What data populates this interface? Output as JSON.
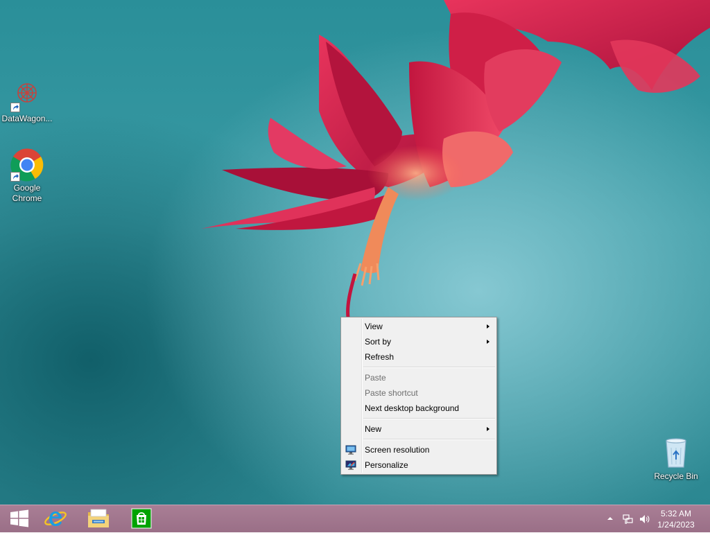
{
  "desktop": {
    "icons": [
      {
        "label": "DataWagon..."
      },
      {
        "label": "Google Chrome"
      },
      {
        "label": "Recycle Bin"
      }
    ]
  },
  "context_menu": {
    "items": [
      {
        "label": "View",
        "submenu": true,
        "enabled": true
      },
      {
        "label": "Sort by",
        "submenu": true,
        "enabled": true
      },
      {
        "label": "Refresh",
        "enabled": true
      },
      {
        "label": "Paste",
        "enabled": false
      },
      {
        "label": "Paste shortcut",
        "enabled": false
      },
      {
        "label": "Next desktop background",
        "enabled": true
      },
      {
        "label": "New",
        "submenu": true,
        "enabled": true
      },
      {
        "label": "Screen resolution",
        "icon": "display-icon",
        "enabled": true
      },
      {
        "label": "Personalize",
        "icon": "personalize-icon",
        "enabled": true
      }
    ]
  },
  "taskbar": {
    "pinned": [
      {
        "icon": "windows-start-icon"
      },
      {
        "icon": "internet-explorer-icon"
      },
      {
        "icon": "file-explorer-icon"
      },
      {
        "icon": "store-icon"
      }
    ],
    "tray": {
      "icons": [
        "show-hidden-icons-chevron",
        "network-icon",
        "volume-icon"
      ],
      "time": "5:32 AM",
      "date": "1/24/2023"
    }
  },
  "colors": {
    "taskbar": "#a47a90",
    "menu_background": "#f0f0f0",
    "menu_disabled_text": "#6d6d6d",
    "wallpaper_teal": "#3a9aa4",
    "flower_red": "#d8234a"
  }
}
